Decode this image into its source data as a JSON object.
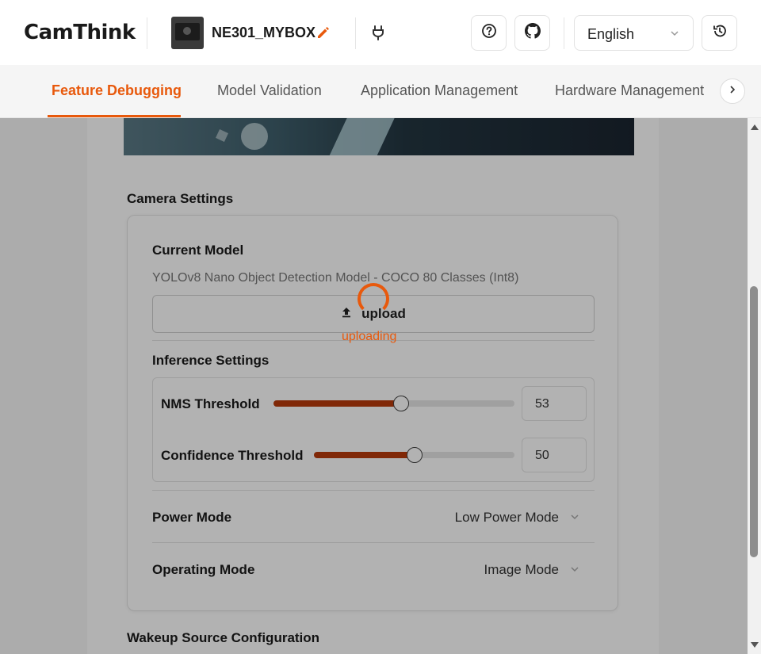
{
  "header": {
    "logo": {
      "part1": "Cam",
      "part2": "Think"
    },
    "device_name": "NE301_MYBOX",
    "language": "English",
    "icons": [
      "help-icon",
      "github-icon",
      "history-icon",
      "edit-icon",
      "plug-icon"
    ]
  },
  "tabs": [
    {
      "label": "Feature Debugging",
      "active": true
    },
    {
      "label": "Model Validation",
      "active": false
    },
    {
      "label": "Application Management",
      "active": false
    },
    {
      "label": "Hardware Management",
      "active": false
    }
  ],
  "camera_settings": {
    "title": "Camera Settings",
    "current_model_label": "Current Model",
    "current_model_value": "YOLOv8 Nano Object Detection Model - COCO 80 Classes (Int8)",
    "upload_label": "upload",
    "uploading_text": "uploading",
    "inference_title": "Inference Settings",
    "nms": {
      "label": "NMS Threshold",
      "value": 53,
      "fraction": 0.53
    },
    "confidence": {
      "label": "Confidence Threshold",
      "value": 50,
      "fraction": 0.5
    },
    "power_mode": {
      "label": "Power Mode",
      "value": "Low Power Mode"
    },
    "operating_mode": {
      "label": "Operating Mode",
      "value": "Image Mode"
    }
  },
  "wakeup_title": "Wakeup Source Configuration",
  "colors": {
    "accent": "#e8590c",
    "slider_fill": "#b83a0b"
  }
}
